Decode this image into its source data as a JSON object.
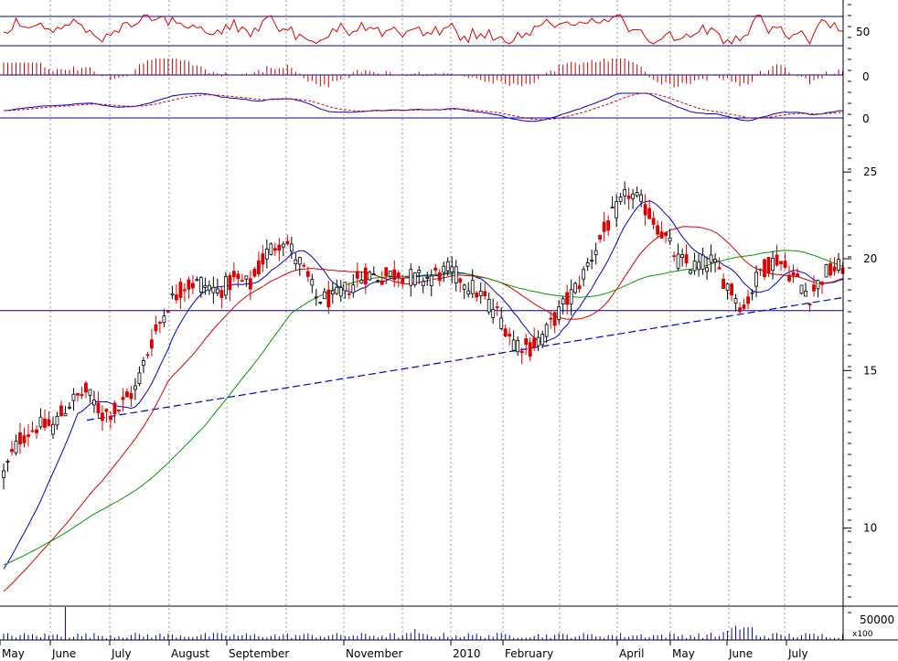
{
  "chart_data": {
    "type": "candlestick",
    "title": "",
    "x_labels": [
      "May",
      "June",
      "July",
      "August",
      "September",
      "November",
      "2010",
      "February",
      "April",
      "May",
      "June",
      "July"
    ],
    "price_axis": {
      "scale": "log",
      "ylim": [
        8.2,
        28
      ],
      "ticks": [
        "25",
        "20",
        "15",
        "10"
      ]
    },
    "panels": {
      "rsi": {
        "tick": "50",
        "upper": 70,
        "lower": 30
      },
      "momentum": {
        "tick": "0"
      },
      "macd": {
        "tick": "0"
      }
    },
    "volume": {
      "tick": "50000",
      "unit_label": "x100"
    },
    "support_level": 17.5,
    "trendline": {
      "from": 13.2,
      "to": 18.1
    },
    "series_names": [
      "Price",
      "MA short (blue)",
      "MA medium (red)",
      "MA long (green)"
    ],
    "close_profile": [
      [
        0,
        11.5
      ],
      [
        4,
        12.6
      ],
      [
        8,
        13.0
      ],
      [
        12,
        13.0
      ],
      [
        16,
        13.8
      ],
      [
        20,
        14.2
      ],
      [
        24,
        13.4
      ],
      [
        28,
        13.6
      ],
      [
        32,
        14.3
      ],
      [
        36,
        16.2
      ],
      [
        40,
        17.8
      ],
      [
        44,
        18.7
      ],
      [
        48,
        18.8
      ],
      [
        52,
        18.4
      ],
      [
        56,
        18.9
      ],
      [
        60,
        18.7
      ],
      [
        64,
        20.3
      ],
      [
        68,
        21.1
      ],
      [
        72,
        19.8
      ],
      [
        76,
        18.1
      ],
      [
        80,
        18.0
      ],
      [
        84,
        18.6
      ],
      [
        88,
        19.2
      ],
      [
        92,
        19.1
      ],
      [
        96,
        19.3
      ],
      [
        100,
        19.0
      ],
      [
        104,
        19.1
      ],
      [
        108,
        19.4
      ],
      [
        112,
        18.9
      ],
      [
        116,
        18.2
      ],
      [
        120,
        17.4
      ],
      [
        124,
        16.2
      ],
      [
        128,
        15.9
      ],
      [
        132,
        16.6
      ],
      [
        136,
        17.7
      ],
      [
        140,
        18.8
      ],
      [
        144,
        20.6
      ],
      [
        148,
        22.3
      ],
      [
        152,
        23.7
      ],
      [
        156,
        22.8
      ],
      [
        160,
        21.4
      ],
      [
        164,
        19.9
      ],
      [
        168,
        19.6
      ],
      [
        172,
        19.9
      ],
      [
        176,
        18.7
      ],
      [
        180,
        17.6
      ],
      [
        184,
        19.4
      ],
      [
        188,
        20.0
      ],
      [
        192,
        19.1
      ],
      [
        196,
        18.2
      ],
      [
        200,
        19.3
      ],
      [
        204,
        19.6
      ]
    ]
  }
}
